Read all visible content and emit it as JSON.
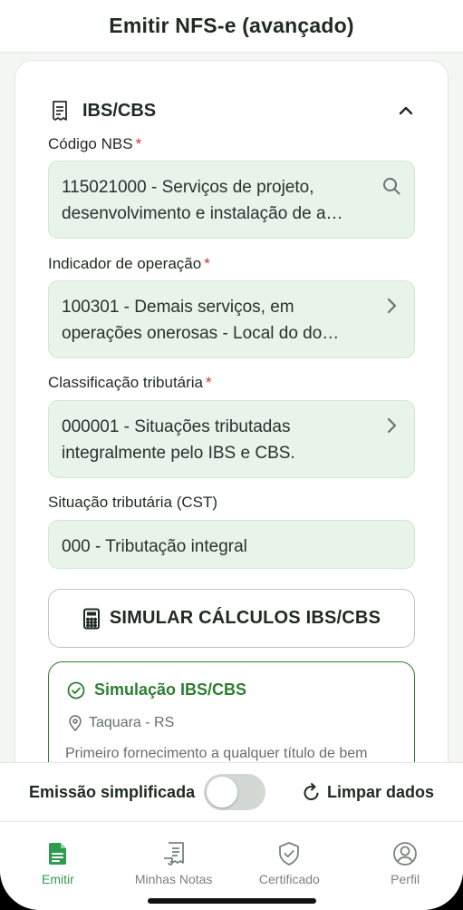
{
  "header": {
    "title": "Emitir NFS-e (avançado)"
  },
  "section": {
    "title": "IBS/CBS",
    "icon": "receipt-icon",
    "toggle_icon": "chevron-up-icon"
  },
  "fields": [
    {
      "label": "Código NBS",
      "required_mark": "*",
      "line1": "115021000 - Serviços de projeto,",
      "line2": "desenvolvimento e instalação de a…",
      "icon": "search-icon"
    },
    {
      "label": "Indicador de operação",
      "required_mark": "*",
      "line1": "100301 - Demais serviços, em",
      "line2": "operações onerosas - Local do do…",
      "icon": "chevron-right-icon"
    },
    {
      "label": "Classificação tributária",
      "required_mark": "*",
      "line1": "000001 - Situações tributadas",
      "line2": "integralmente pelo IBS e CBS.",
      "icon": "chevron-right-icon"
    },
    {
      "label": "Situação tributária (CST)",
      "value": "000 - Tributação integral"
    }
  ],
  "simulate_button": {
    "label": "SIMULAR CÁLCULOS IBS/CBS",
    "icon": "calculator-icon"
  },
  "simulation": {
    "title": "Simulação IBS/CBS",
    "location": "Taquara - RS",
    "description": "Primeiro fornecimento a qualquer título de bem",
    "accent": "#2e7d32"
  },
  "bottom_bar": {
    "simplified_label": "Emissão simplificada",
    "simplified_on": false,
    "clear_label": "Limpar dados"
  },
  "tabs": [
    {
      "label": "Emitir",
      "icon": "document-icon",
      "active": true
    },
    {
      "label": "Minhas Notas",
      "icon": "receipt-icon",
      "active": false
    },
    {
      "label": "Certificado",
      "icon": "shield-check-icon",
      "active": false
    },
    {
      "label": "Perfil",
      "icon": "user-circle-icon",
      "active": false
    }
  ],
  "colors": {
    "field_bg": "#e8f3ea",
    "active_tab": "#2e9b4f",
    "required": "#d32f2f"
  }
}
